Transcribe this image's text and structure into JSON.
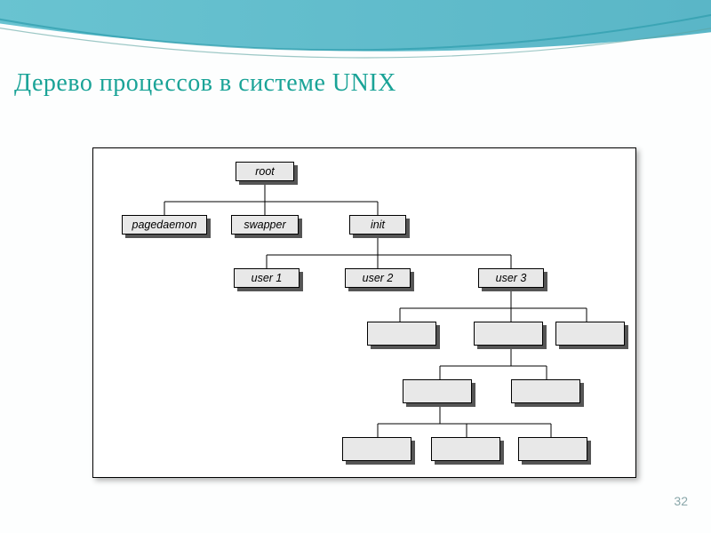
{
  "slide": {
    "title": "Дерево процессов в системе UNIX",
    "page_number": "32"
  },
  "nodes": {
    "root": "root",
    "pagedaemon": "pagedaemon",
    "swapper": "swapper",
    "init": "init",
    "user1": "user 1",
    "user2": "user 2",
    "user3": "user 3",
    "l4a": "",
    "l4b": "",
    "l4c": "",
    "l5a": "",
    "l5b": "",
    "l6a": "",
    "l6b": "",
    "l6c": ""
  }
}
